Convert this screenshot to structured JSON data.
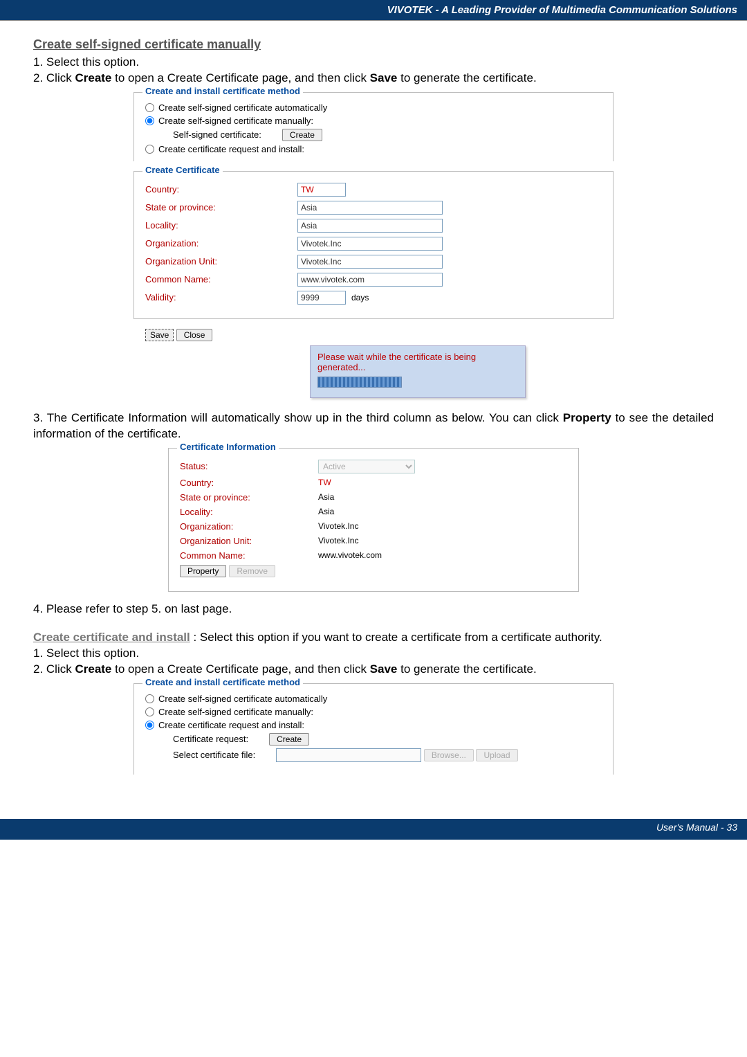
{
  "header": {
    "title": "VIVOTEK - A Leading Provider of Multimedia Communication Solutions"
  },
  "sec1": {
    "title": "Create self-signed certificate manually",
    "step1": "1. Select this option.",
    "step2a": "2. Click ",
    "step2b": "Create",
    "step2c": " to open a Create Certificate page, and then click ",
    "step2d": "Save",
    "step2e": " to generate the certificate."
  },
  "methodBox1": {
    "legend": "Create and install certificate method",
    "opt1": "Create self-signed certificate automatically",
    "opt2": "Create self-signed certificate manually:",
    "subLabel": "Self-signed certificate:",
    "createBtn": "Create",
    "opt3": "Create certificate request and install:"
  },
  "createCert": {
    "legend": "Create Certificate",
    "country": "Country:",
    "countryVal": "TW",
    "state": "State or province:",
    "stateVal": "Asia",
    "locality": "Locality:",
    "localityVal": "Asia",
    "org": "Organization:",
    "orgVal": "Vivotek.Inc",
    "orgUnit": "Organization Unit:",
    "orgUnitVal": "Vivotek.Inc",
    "common": "Common Name:",
    "commonVal": "www.vivotek.com",
    "validity": "Validity:",
    "validityVal": "9999",
    "days": "days"
  },
  "buttons": {
    "save": "Save",
    "close": "Close"
  },
  "statusMsg": "Please wait while the certificate is being generated...",
  "step3a": "3. The Certificate Information will automatically show up in the third column as below. You can click ",
  "step3b": "Property",
  "step3c": " to see the detailed information of the certificate.",
  "certInfo": {
    "legend": "Certificate Information",
    "statusLbl": "Status:",
    "statusVal": "Active",
    "country": "Country:",
    "countryVal": "TW",
    "state": "State or province:",
    "stateVal": "Asia",
    "locality": "Locality:",
    "localityVal": "Asia",
    "org": "Organization:",
    "orgVal": "Vivotek.Inc",
    "orgUnit": "Organization Unit:",
    "orgUnitVal": "Vivotek.Inc",
    "common": "Common Name:",
    "commonVal": "www.vivotek.com",
    "propertyBtn": "Property",
    "removeBtn": "Remove"
  },
  "step4": "4. Please refer to step 5. on last page.",
  "sec2": {
    "title": "Create certificate and install",
    "desc": " :  Select this option if you want to create a certificate from a certificate authority.",
    "step1": "1. Select this option.",
    "step2a": "2. Click ",
    "step2b": "Create",
    "step2c": " to open a Create Certificate page, and then click ",
    "step2d": "Save",
    "step2e": " to generate the certificate."
  },
  "methodBox2": {
    "legend": "Create and install certificate method",
    "opt1": "Create self-signed certificate automatically",
    "opt2": "Create self-signed certificate manually:",
    "opt3": "Create certificate request and install:",
    "reqLabel": "Certificate request:",
    "createBtn": "Create",
    "fileLabel": "Select certificate file:",
    "browseBtn": "Browse...",
    "uploadBtn": "Upload"
  },
  "footer": {
    "text": "User's Manual - 33"
  }
}
